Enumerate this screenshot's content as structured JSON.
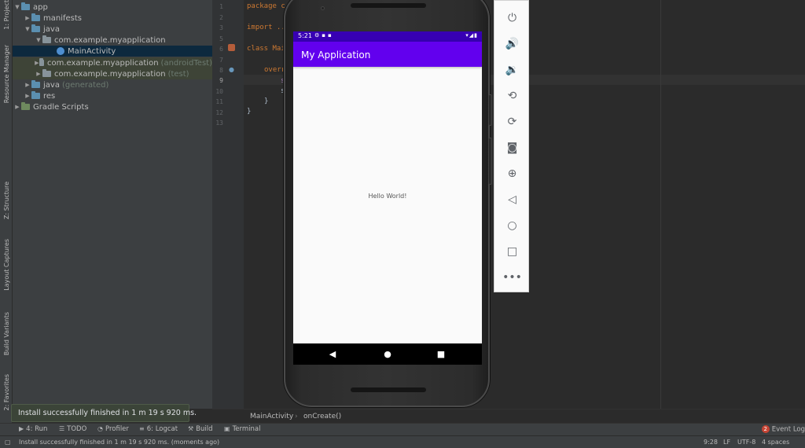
{
  "left_tool_tabs": [
    {
      "label": "1: Project",
      "icon": "folder-icon"
    },
    {
      "label": "Resource Manager",
      "icon": "resource-icon"
    },
    {
      "label": "Z: Structure",
      "icon": "structure-icon"
    },
    {
      "label": "Layout Captures",
      "icon": "layout-captures-icon"
    },
    {
      "label": "Build Variants",
      "icon": "build-variants-icon"
    },
    {
      "label": "2: Favorites",
      "icon": "star-icon"
    }
  ],
  "project_tree": [
    {
      "label": "app",
      "suffix": ""
    },
    {
      "label": "manifests",
      "suffix": ""
    },
    {
      "label": "java",
      "suffix": ""
    },
    {
      "label": "com.example.myapplication",
      "suffix": ""
    },
    {
      "label": "MainActivity",
      "suffix": ""
    },
    {
      "label": "com.example.myapplication",
      "suffix": "(androidTest)"
    },
    {
      "label": "com.example.myapplication",
      "suffix": "(test)"
    },
    {
      "label": "java",
      "suffix": "(generated)"
    },
    {
      "label": "res",
      "suffix": ""
    },
    {
      "label": "Gradle Scripts",
      "suffix": ""
    }
  ],
  "editor": {
    "line_numbers": [
      "1",
      "2",
      "3",
      "5",
      "6",
      "7",
      "8",
      "9",
      "10",
      "11",
      "12",
      "13"
    ],
    "lines": [
      "package c",
      "import ...",
      "class Mai",
      "overr",
      "s",
      "s",
      "}",
      "}"
    ]
  },
  "breadcrumb": {
    "file": "MainActivity",
    "method": "onCreate()"
  },
  "bottom_tabs": [
    {
      "label": "Run",
      "prefix": "4:",
      "icon": "run-icon"
    },
    {
      "label": "TODO",
      "prefix": "",
      "icon": "todo-icon"
    },
    {
      "label": "Profiler",
      "prefix": "",
      "icon": "profiler-icon"
    },
    {
      "label": "Logcat",
      "prefix": "6:",
      "icon": "logcat-icon"
    },
    {
      "label": "Build",
      "prefix": "",
      "icon": "build-icon"
    },
    {
      "label": "Terminal",
      "prefix": "",
      "icon": "terminal-icon"
    }
  ],
  "event_log": {
    "count": "2",
    "label": "Event Log"
  },
  "toast": {
    "message": "Install successfully finished in 1 m 19 s 920 ms."
  },
  "status_bar": {
    "message": "Install successfully finished in 1 m 19 s 920 ms. (moments ago)",
    "position": "9:28",
    "line_sep": "LF",
    "encoding": "UTF-8",
    "indent": "4 spaces"
  },
  "phone": {
    "time": "5:21",
    "app_title": "My Application",
    "body_text": "Hello World!",
    "colors": {
      "status_bar": "#3700b3",
      "app_bar": "#6200ee"
    }
  },
  "emulator_toolbar": [
    "power-icon",
    "volume-up-icon",
    "volume-down-icon",
    "rotate-left-icon",
    "rotate-right-icon",
    "screenshot-icon",
    "zoom-icon",
    "back-icon",
    "home-icon",
    "overview-icon",
    "more-icon"
  ]
}
